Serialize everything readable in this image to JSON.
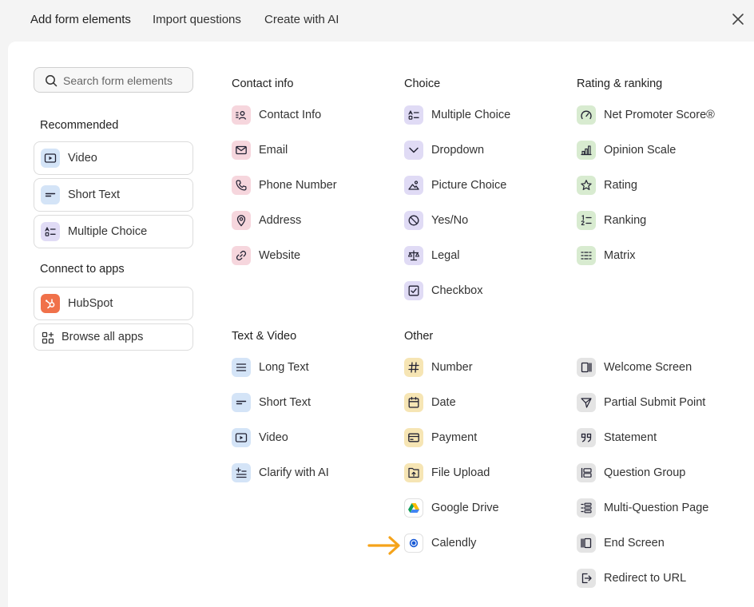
{
  "tabs": [
    "Add form elements",
    "Import questions",
    "Create with AI"
  ],
  "search": {
    "placeholder": "Search form elements"
  },
  "left": {
    "recommended_title": "Recommended",
    "recommended": [
      "Video",
      "Short Text",
      "Multiple Choice"
    ],
    "apps_title": "Connect to apps",
    "apps": [
      "HubSpot"
    ],
    "browse_label": "Browse all apps"
  },
  "groups": {
    "contact": {
      "title": "Contact info",
      "items": [
        "Contact Info",
        "Email",
        "Phone Number",
        "Address",
        "Website"
      ]
    },
    "choice": {
      "title": "Choice",
      "items": [
        "Multiple Choice",
        "Dropdown",
        "Picture Choice",
        "Yes/No",
        "Legal",
        "Checkbox"
      ]
    },
    "rating": {
      "title": "Rating & ranking",
      "items": [
        "Net Promoter Score®",
        "Opinion Scale",
        "Rating",
        "Ranking",
        "Matrix"
      ]
    },
    "text": {
      "title": "Text & Video",
      "items": [
        "Long Text",
        "Short Text",
        "Video",
        "Clarify with AI"
      ]
    },
    "other": {
      "title": "Other",
      "items": [
        "Number",
        "Date",
        "Payment",
        "File Upload",
        "Google Drive",
        "Calendly"
      ]
    },
    "other2": {
      "items": [
        "Welcome Screen",
        "Partial Submit Point",
        "Statement",
        "Question Group",
        "Multi-Question Page",
        "End Screen",
        "Redirect to URL"
      ]
    }
  },
  "colors": {
    "contact": "#f6d6dd",
    "choice": "#e0dbf5",
    "rating": "#d8ebd0",
    "text": "#d4e4f7",
    "other": "#f6e5b4",
    "other2": "#e4e4e4",
    "hubspot": "#f0714a",
    "arrow": "#f5a31a"
  },
  "icons": {
    "contact": [
      "contact-card-icon",
      "envelope-icon",
      "phone-icon",
      "map-pin-icon",
      "link-icon"
    ],
    "choice": [
      "checklist-icon",
      "chevron-down-icon",
      "image-icon",
      "ban-icon",
      "scale-icon",
      "checkbox-icon"
    ],
    "rating": [
      "gauge-icon",
      "bar-chart-icon",
      "star-icon",
      "ranking-icon",
      "grid-icon"
    ],
    "text": [
      "long-text-icon",
      "short-text-icon",
      "video-play-icon",
      "sparkle-text-icon"
    ],
    "other": [
      "hash-icon",
      "calendar-icon",
      "credit-card-icon",
      "file-upload-icon",
      "google-drive-icon",
      "calendly-icon"
    ],
    "other2": [
      "welcome-screen-icon",
      "send-icon",
      "quote-icon",
      "question-group-icon",
      "multi-question-icon",
      "end-screen-icon",
      "redirect-icon"
    ]
  }
}
